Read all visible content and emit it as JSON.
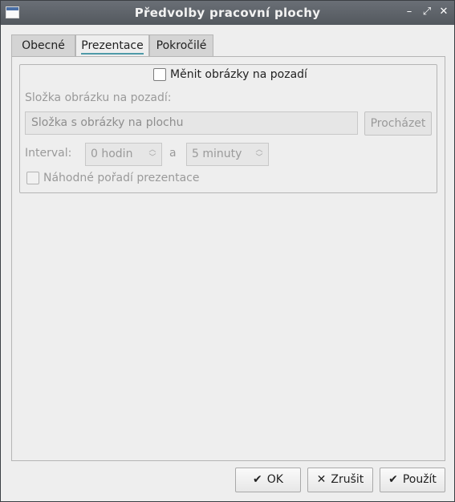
{
  "window": {
    "title": "Předvolby pracovní plochy",
    "controls": {
      "minimize": "–",
      "maximize": "⤢",
      "close": "✕"
    }
  },
  "tabs": [
    {
      "label": "Obecné"
    },
    {
      "label": "Prezentace",
      "selected": true
    },
    {
      "label": "Pokročilé"
    }
  ],
  "slideshow": {
    "change_background_label": "Měnit obrázky na pozadí",
    "change_background_checked": false,
    "folder_label": "Složka obrázku na pozadí:",
    "folder_placeholder": "Složka s obrázky na plochu",
    "browse_label": "Procházet",
    "interval_label": "Interval:",
    "hours_value": "0 hodin",
    "and_label": "a",
    "minutes_value": "5 minuty",
    "random_order_label": "Náhodné pořadí prezentace",
    "random_order_checked": false
  },
  "buttons": {
    "ok_icon": "✔",
    "ok": "OK",
    "cancel_icon": "✕",
    "cancel": "Zrušit",
    "apply_icon": "✔",
    "apply": "Použít"
  }
}
